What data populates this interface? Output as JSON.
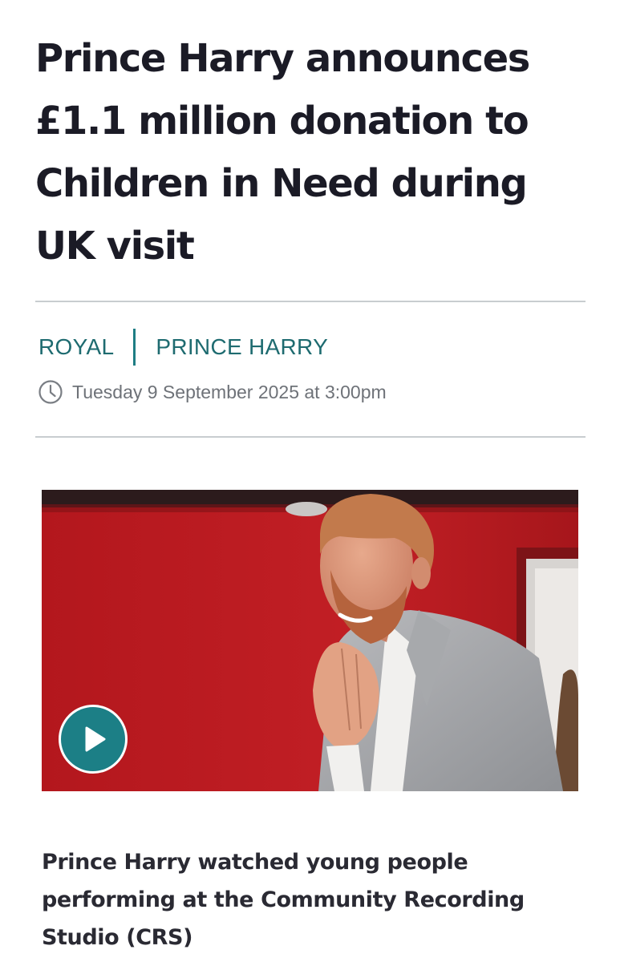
{
  "article": {
    "headline": "Prince Harry announces £1.1 million donation to Children in Need during UK visit",
    "tags": [
      "ROYAL",
      "PRINCE HARRY"
    ],
    "timestamp": "Tuesday 9 September 2025 at 3:00pm"
  },
  "media": {
    "play_icon": "play-icon",
    "caption": "Prince Harry watched young people performing at the Community Recording Studio (CRS)"
  },
  "theme": {
    "accent": "#1e6b70",
    "play_button": "#1c7f86",
    "headline_color": "#1b1b26",
    "meta_color": "#6e7278",
    "rule_color": "#c8cdd0"
  }
}
